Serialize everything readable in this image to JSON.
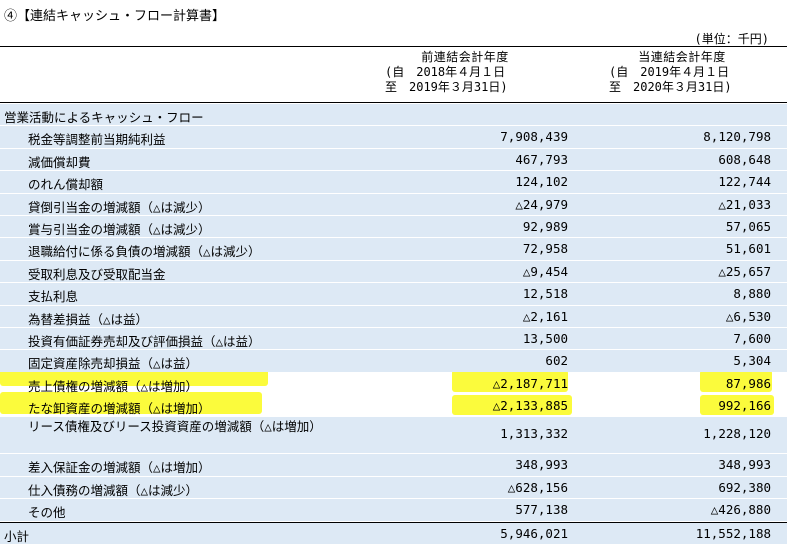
{
  "title": "④【連結キャッシュ・フロー計算書】",
  "unit": "(単位：千円)",
  "columns": {
    "prev": {
      "line1": "前連結会計年度",
      "line2": "(自　2018年４月１日",
      "line3": "至　2019年３月31日)"
    },
    "curr": {
      "line1": "当連結会計年度",
      "line2": "(自　2019年４月１日",
      "line3": "至　2020年３月31日)"
    }
  },
  "section_title": "営業活動によるキャッシュ・フロー",
  "rows": [
    {
      "label": "税金等調整前当期純利益",
      "prev": "7,908,439",
      "curr": "8,120,798"
    },
    {
      "label": "減価償却費",
      "prev": "467,793",
      "curr": "608,648"
    },
    {
      "label": "のれん償却額",
      "prev": "124,102",
      "curr": "122,744"
    },
    {
      "label": "貸倒引当金の増減額（△は減少）",
      "prev": "△24,979",
      "curr": "△21,033"
    },
    {
      "label": "賞与引当金の増減額（△は減少）",
      "prev": "92,989",
      "curr": "57,065"
    },
    {
      "label": "退職給付に係る負債の増減額（△は減少）",
      "prev": "72,958",
      "curr": "51,601"
    },
    {
      "label": "受取利息及び受取配当金",
      "prev": "△9,454",
      "curr": "△25,657"
    },
    {
      "label": "支払利息",
      "prev": "12,518",
      "curr": "8,880"
    },
    {
      "label": "為替差損益（△は益）",
      "prev": "△2,161",
      "curr": "△6,530"
    },
    {
      "label": "投資有価証券売却及び評価損益（△は益）",
      "prev": "13,500",
      "curr": "7,600"
    },
    {
      "label": "固定資産除売却損益（△は益）",
      "prev": "602",
      "curr": "5,304"
    },
    {
      "label": "売上債権の増減額（△は増加）",
      "prev": "△2,187,711",
      "curr": "87,986"
    },
    {
      "label": "たな卸資産の増減額（△は増加）",
      "prev": "△2,133,885",
      "curr": "992,166"
    },
    {
      "label": "リース債権及びリース投資資産の増減額（△は増加）",
      "prev": "1,313,332",
      "curr": "1,228,120"
    },
    {
      "label": "差入保証金の増減額（△は増加）",
      "prev": "348,993",
      "curr": "348,993"
    },
    {
      "label": "仕入債務の増減額（△は減少）",
      "prev": "△628,156",
      "curr": "692,380"
    },
    {
      "label": "その他",
      "prev": "577,138",
      "curr": "△426,880"
    }
  ],
  "subtotal": {
    "label": "小計",
    "prev": "5,946,021",
    "curr": "11,552,188"
  }
}
